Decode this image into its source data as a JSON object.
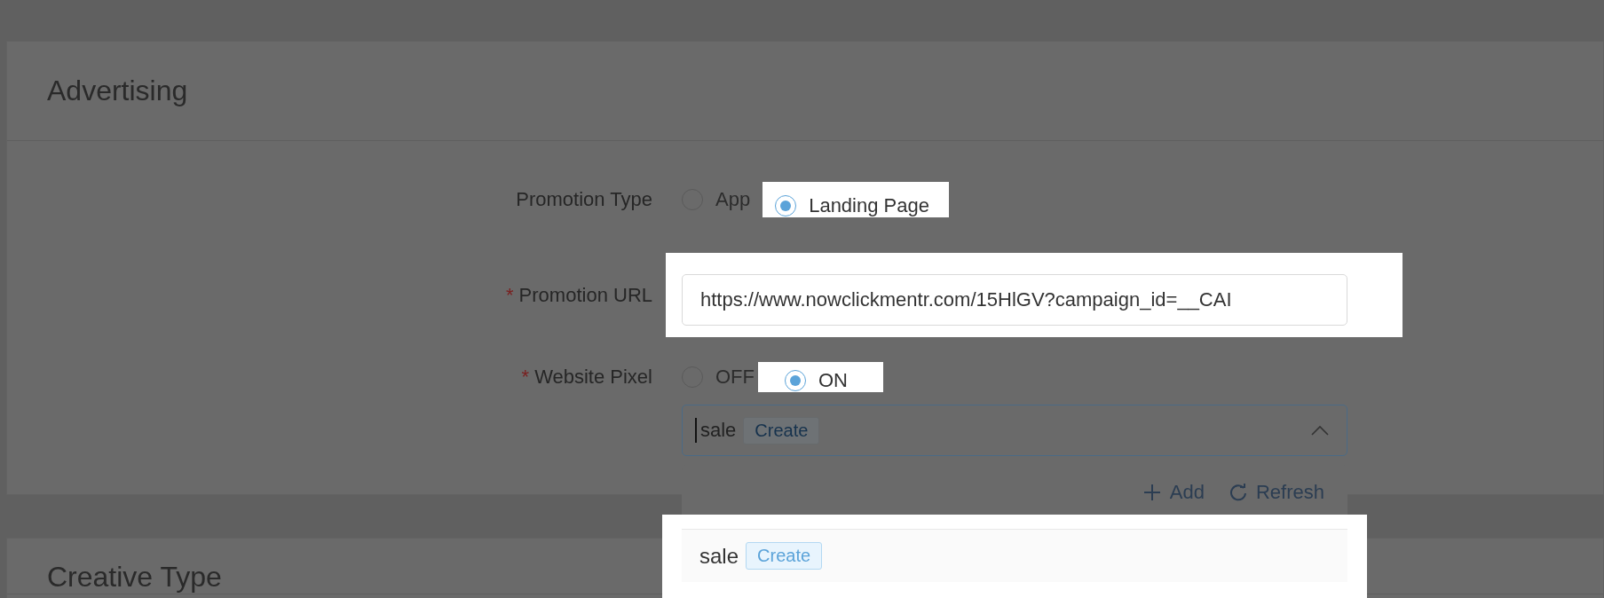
{
  "sections": [
    {
      "title": "Advertising"
    },
    {
      "title": "Creative Type"
    }
  ],
  "promotion_type": {
    "label": "Promotion Type",
    "options": [
      {
        "label": "App",
        "selected": false,
        "highlighted": false
      },
      {
        "label": "Landing Page",
        "selected": true,
        "highlighted": true
      }
    ]
  },
  "promotion_url": {
    "label": "Promotion URL",
    "required_mark": "*",
    "value": "https://www.nowclickmentr.com/15HlGV?campaign_id=__CAI",
    "highlighted": true
  },
  "website_pixel": {
    "label": "Website Pixel",
    "required_mark": "*",
    "options": [
      {
        "label": "OFF",
        "selected": false,
        "highlighted": false
      },
      {
        "label": "ON",
        "selected": true,
        "highlighted": true
      }
    ]
  },
  "pixel_select": {
    "value": "sale",
    "tag": "Create",
    "expanded": true,
    "actions": [
      {
        "kind": "add",
        "label": "Add"
      },
      {
        "kind": "refresh",
        "label": "Refresh"
      }
    ],
    "options": [
      {
        "label": "sale",
        "tag": "Create",
        "highlighted": true
      }
    ]
  }
}
